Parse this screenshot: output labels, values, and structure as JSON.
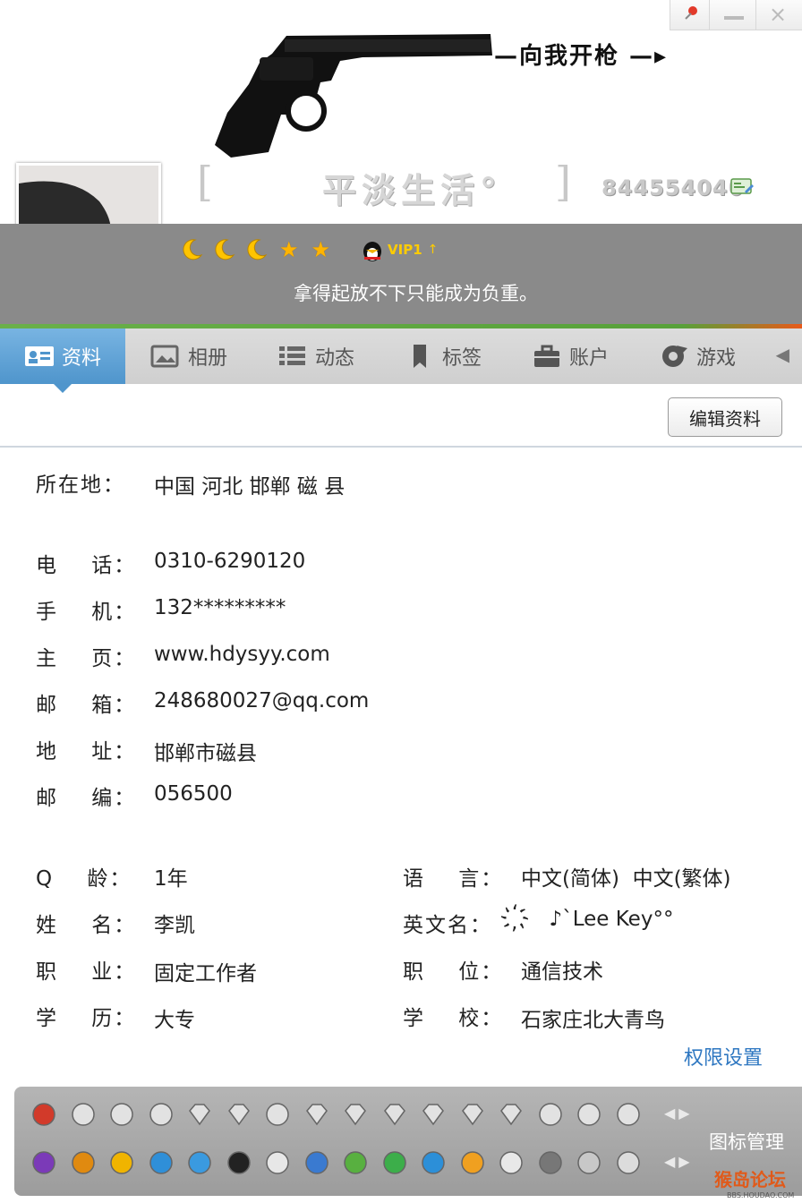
{
  "header": {
    "slogan": "—向我开枪 —▸",
    "nickname": "平淡生活°",
    "bracket_left": "[",
    "bracket_right": "]",
    "qq_number": "844554040",
    "vip_label": "VIP1",
    "vip_up": "↑",
    "signature": "拿得起放不下只能成为负重。",
    "level_icons": [
      "moon-icon",
      "moon-icon",
      "moon-icon",
      "star-icon",
      "star-icon"
    ],
    "star_glyph": "★"
  },
  "window": {
    "close_glyph": "×"
  },
  "tabs": [
    {
      "label": "资料",
      "icon": "profile-card-icon"
    },
    {
      "label": "相册",
      "icon": "photo-album-icon"
    },
    {
      "label": "动态",
      "icon": "feed-list-icon"
    },
    {
      "label": "标签",
      "icon": "bookmark-tag-icon"
    },
    {
      "label": "账户",
      "icon": "briefcase-icon"
    },
    {
      "label": "游戏",
      "icon": "game-icon"
    }
  ],
  "tab_scroll": "◀",
  "edit_button": "编辑资料",
  "profile": {
    "location": {
      "label": "所在地：",
      "value": "中国 河北 邯郸 磁  县"
    },
    "phone": {
      "label": "电    话：",
      "value": "0310-6290120"
    },
    "mobile": {
      "label": "手    机：",
      "value": "132*********"
    },
    "homepage": {
      "label": "主    页：",
      "value": "www.hdysyy.com"
    },
    "email": {
      "label": "邮    箱：",
      "value": "248680027@qq.com"
    },
    "address": {
      "label": "地    址：",
      "value": "邯郸市磁县"
    },
    "postcode": {
      "label": "邮    编：",
      "value": "056500"
    },
    "qq_age": {
      "label": "Q    龄：",
      "value": "1年"
    },
    "language": {
      "label": "语    言：",
      "value": "中文(简体)  中文(繁体)"
    },
    "name": {
      "label": "姓    名：",
      "value": "李凯"
    },
    "english_name": {
      "label": "英文名：",
      "value": "҉   ♪`Lee Key°°"
    },
    "occupation": {
      "label": "职    业：",
      "value": "固定工作者"
    },
    "position": {
      "label": "职    位：",
      "value": "通信技术"
    },
    "education": {
      "label": "学    历：",
      "value": "大专"
    },
    "school": {
      "label": "学    校：",
      "value": "石家庄北大青鸟"
    }
  },
  "permission_link": "权限设置",
  "icon_bar": {
    "manage_label": "图标管理",
    "row_arrows": "◀▶",
    "row1": [
      "qq-penguin-icon",
      "heart-icon",
      "heart-icon",
      "penguin-helmet-icon",
      "diamond-icon",
      "diamond-outline-icon",
      "phone-icon",
      "diamond-outline-icon",
      "diamond-outline-icon",
      "diamond-outline-icon",
      "diamond-outline-icon",
      "diamond-outline-icon",
      "diamond-outline-icon",
      "phone-icon",
      "heart-dark-icon",
      "superman-shield-icon"
    ],
    "row2": [
      "dragon-icon",
      "game-mahjong-icon",
      "star-badge-icon",
      "qzone-icon",
      "qq-show-icon",
      "penguin-icon",
      "mail-icon",
      "document-icon",
      "house-icon",
      "music-icon",
      "browser-icon",
      "pet-icon",
      "eye-icon",
      "app-icon",
      "chat-bubble-icon",
      "shield-icon"
    ],
    "colors": {
      "accent_blue": "#4f95cc",
      "accent_green": "#57a13a",
      "link_blue": "#2e77c1"
    }
  },
  "watermark": {
    "text": "猴岛论坛",
    "sub": "BBS.HOUDAO.COM"
  }
}
